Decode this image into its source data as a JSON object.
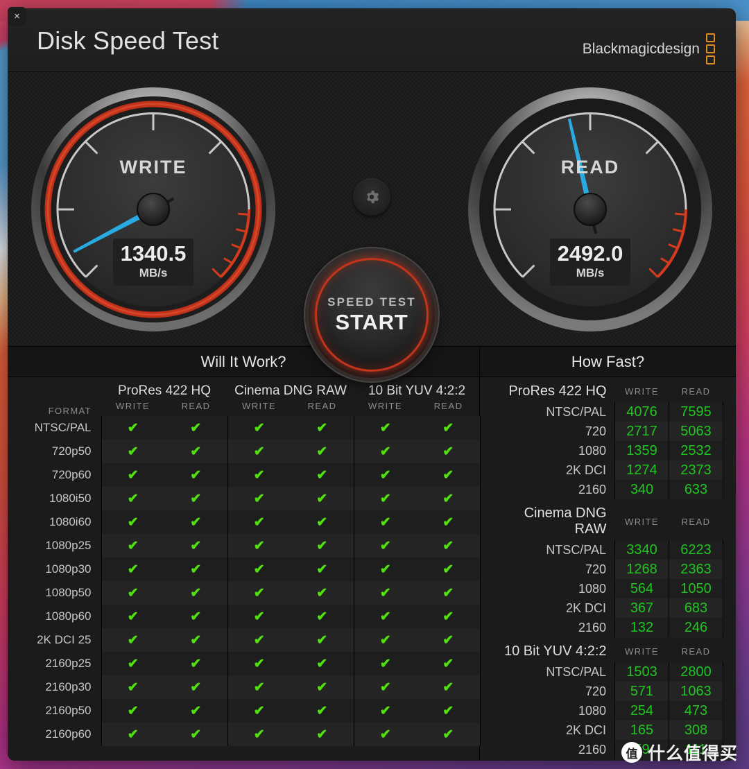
{
  "window": {
    "title": "Disk Speed Test",
    "close_label": "×",
    "brand": "Blackmagicdesign"
  },
  "gauges": {
    "write": {
      "label": "WRITE",
      "value": "1340.5",
      "unit": "MB/s",
      "needle_deg": -118,
      "max": 5000
    },
    "read": {
      "label": "READ",
      "value": "2492.0",
      "unit": "MB/s",
      "needle_deg": -13,
      "max": 5000
    }
  },
  "controls": {
    "settings_icon": "gear-icon",
    "start_top": "SPEED TEST",
    "start_main": "START"
  },
  "colors": {
    "accent_red": "#c3351b",
    "needle_blue": "#29ABE2",
    "check_green": "#52e012",
    "value_green": "#21c521",
    "brand_orange": "#e08a1e"
  },
  "will_it_work": {
    "title": "Will It Work?",
    "format_header": "FORMAT",
    "groups": [
      "ProRes 422 HQ",
      "Cinema DNG RAW",
      "10 Bit YUV 4:2:2"
    ],
    "sub_headers": [
      "WRITE",
      "READ"
    ],
    "check_glyph": "✔",
    "rows": [
      {
        "format": "NTSC/PAL",
        "cells": [
          true,
          true,
          true,
          true,
          true,
          true
        ]
      },
      {
        "format": "720p50",
        "cells": [
          true,
          true,
          true,
          true,
          true,
          true
        ]
      },
      {
        "format": "720p60",
        "cells": [
          true,
          true,
          true,
          true,
          true,
          true
        ]
      },
      {
        "format": "1080i50",
        "cells": [
          true,
          true,
          true,
          true,
          true,
          true
        ]
      },
      {
        "format": "1080i60",
        "cells": [
          true,
          true,
          true,
          true,
          true,
          true
        ]
      },
      {
        "format": "1080p25",
        "cells": [
          true,
          true,
          true,
          true,
          true,
          true
        ]
      },
      {
        "format": "1080p30",
        "cells": [
          true,
          true,
          true,
          true,
          true,
          true
        ]
      },
      {
        "format": "1080p50",
        "cells": [
          true,
          true,
          true,
          true,
          true,
          true
        ]
      },
      {
        "format": "1080p60",
        "cells": [
          true,
          true,
          true,
          true,
          true,
          true
        ]
      },
      {
        "format": "2K DCI 25",
        "cells": [
          true,
          true,
          true,
          true,
          true,
          true
        ]
      },
      {
        "format": "2160p25",
        "cells": [
          true,
          true,
          true,
          true,
          true,
          true
        ]
      },
      {
        "format": "2160p30",
        "cells": [
          true,
          true,
          true,
          true,
          true,
          true
        ]
      },
      {
        "format": "2160p50",
        "cells": [
          true,
          true,
          true,
          true,
          true,
          true
        ]
      },
      {
        "format": "2160p60",
        "cells": [
          true,
          true,
          true,
          true,
          true,
          true
        ]
      }
    ]
  },
  "how_fast": {
    "title": "How Fast?",
    "sub_headers": [
      "WRITE",
      "READ"
    ],
    "sections": [
      {
        "name": "ProRes 422 HQ",
        "rows": [
          {
            "label": "NTSC/PAL",
            "write": "4076",
            "read": "7595"
          },
          {
            "label": "720",
            "write": "2717",
            "read": "5063"
          },
          {
            "label": "1080",
            "write": "1359",
            "read": "2532"
          },
          {
            "label": "2K DCI",
            "write": "1274",
            "read": "2373"
          },
          {
            "label": "2160",
            "write": "340",
            "read": "633"
          }
        ]
      },
      {
        "name": "Cinema DNG RAW",
        "rows": [
          {
            "label": "NTSC/PAL",
            "write": "3340",
            "read": "6223"
          },
          {
            "label": "720",
            "write": "1268",
            "read": "2363"
          },
          {
            "label": "1080",
            "write": "564",
            "read": "1050"
          },
          {
            "label": "2K DCI",
            "write": "367",
            "read": "683"
          },
          {
            "label": "2160",
            "write": "132",
            "read": "246"
          }
        ]
      },
      {
        "name": "10 Bit YUV 4:2:2",
        "rows": [
          {
            "label": "NTSC/PAL",
            "write": "1503",
            "read": "2800"
          },
          {
            "label": "720",
            "write": "571",
            "read": "1063"
          },
          {
            "label": "1080",
            "write": "254",
            "read": "473"
          },
          {
            "label": "2K DCI",
            "write": "165",
            "read": "308"
          },
          {
            "label": "2160",
            "write": "59",
            "read": "111"
          }
        ]
      }
    ]
  },
  "watermark": {
    "logo": "值",
    "text": "什么值得买"
  }
}
